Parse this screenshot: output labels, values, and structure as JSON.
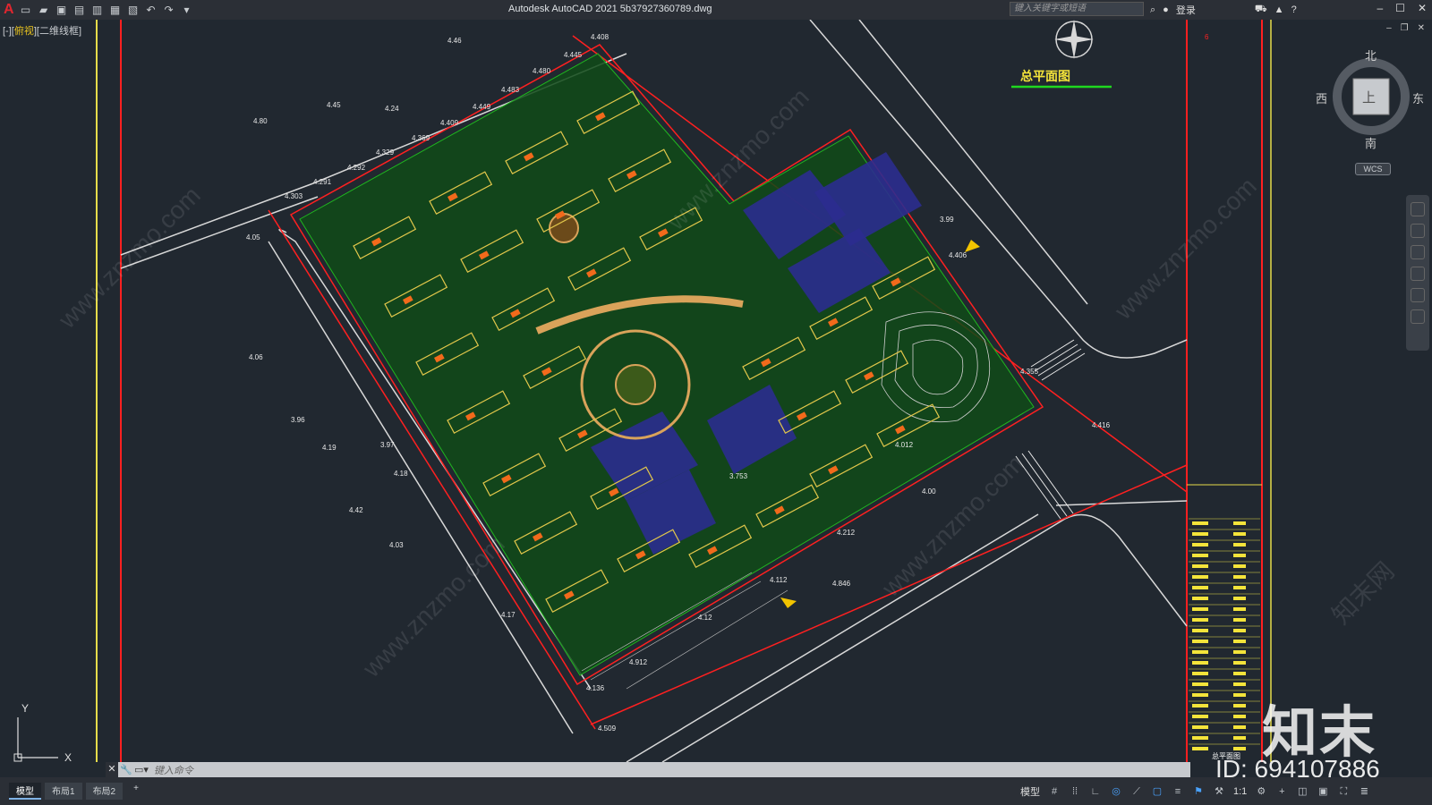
{
  "app": {
    "logo": "A",
    "title": "Autodesk AutoCAD 2021    5b37927360789.dwg",
    "search_placeholder": "键入关键字或短语",
    "login_label": "登录"
  },
  "quick_access": [
    "new-icon",
    "open-icon",
    "save-icon",
    "saveas-icon",
    "plot-preview-icon",
    "publish-icon",
    "print-icon",
    "undo-icon",
    "redo-icon",
    "dropdown-icon"
  ],
  "viewport": {
    "view_label_prefix": "[-][",
    "view_label_view": "俯视",
    "view_label_suffix": "][二维线框]",
    "drawing_title": "总平面图",
    "compass": {
      "north": "北",
      "south": "南",
      "east": "东",
      "west": "西",
      "center": "上"
    },
    "wcs_label": "WCS",
    "elevations": [
      "4.46",
      "4.408",
      "4.445",
      "4.480",
      "4.483",
      "4.45",
      "4.24",
      "4.449",
      "4.80",
      "4.409",
      "4.369",
      "4.329",
      "4.292",
      "4.291",
      "4.303",
      "4.05",
      "4.06",
      "3.96",
      "4.19",
      "3.97",
      "4.18",
      "4.42",
      "4.03",
      "4.17",
      "3.99",
      "4.406",
      "4.355",
      "4.416",
      "4.846",
      "4.509",
      "4.136",
      "3.753",
      "4.00",
      "4.212",
      "4.12",
      "4.912",
      "4.012",
      "4.112"
    ],
    "colors": {
      "background": "#212830",
      "building": "#e2c74b",
      "landscape": "#1fb81f",
      "water": "#2b2c8f",
      "boundary": "#ff2020",
      "road": "#d8d8d8",
      "accent": "#f26a1b"
    }
  },
  "title_block": {
    "right_label": "6",
    "sheet_title": "总平面图"
  },
  "command": {
    "placeholder": "键入命令"
  },
  "layouts": [
    "模型",
    "布局1",
    "布局2",
    "+"
  ],
  "status": {
    "model_label": "模型",
    "scale": "1:1"
  },
  "watermark": {
    "brand": "知末",
    "id": "ID: 694107886",
    "site": "www.znzmo.com",
    "site_cn": "知末网"
  }
}
